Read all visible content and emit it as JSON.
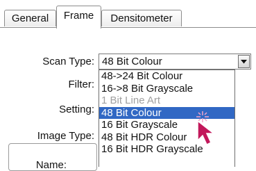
{
  "tabs": [
    {
      "label": "General"
    },
    {
      "label": "Frame"
    },
    {
      "label": "Densitometer"
    }
  ],
  "form": {
    "scan_type_label": "Scan Type:",
    "filter_label": "Filter:",
    "setting_label": "Setting:",
    "image_type_label": "Image Type:",
    "name_label": "Name:"
  },
  "scan_type": {
    "selected": "48 Bit Colour",
    "options": [
      {
        "label": "48->24 Bit Colour",
        "state": "normal"
      },
      {
        "label": "16->8 Bit Grayscale",
        "state": "normal"
      },
      {
        "label": "1 Bit Line Art",
        "state": "disabled"
      },
      {
        "label": "48 Bit Colour",
        "state": "selected"
      },
      {
        "label": "16 Bit Grayscale",
        "state": "normal"
      },
      {
        "label": "48 Bit HDR Colour",
        "state": "normal"
      },
      {
        "label": "16 Bit HDR Grayscale",
        "state": "normal"
      }
    ]
  },
  "colors": {
    "highlight": "#3168c4",
    "cursor": "#c2185b",
    "disabled_text": "#a0a0a0"
  },
  "icons": {
    "dropdown_arrow": "chevron-down-icon",
    "cursor": "pointer-cursor-icon"
  }
}
